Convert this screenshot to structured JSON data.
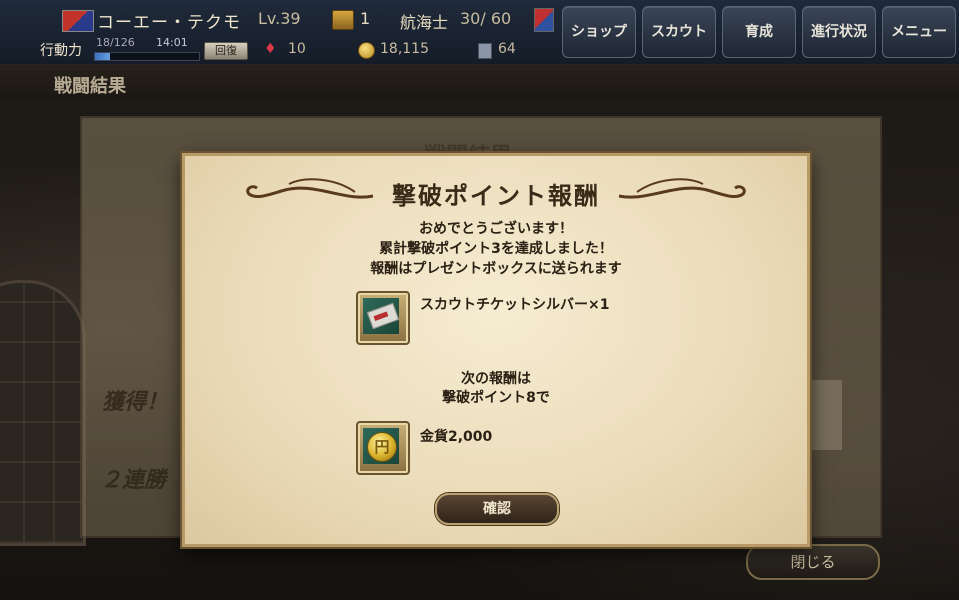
{
  "header": {
    "player_name": "コーエー・テクモ",
    "level": "Lv.39",
    "chest_count": "1",
    "rank_label": "航海士",
    "rank_value": "30/ 60",
    "ap_label": "行動力",
    "ap_value": "18/126",
    "ap_fraction": 0.14,
    "ap_time": "14:01",
    "recover_label": "回復",
    "gem_count": "10",
    "gold_count": "18,115",
    "doc_count": "64"
  },
  "nav": {
    "shop": "ショップ",
    "scout": "スカウト",
    "training": "育成",
    "progress": "進行状況",
    "menu": "メニュー"
  },
  "screen_title": "戦闘結果",
  "background_panel": {
    "heading": "戦闘結果",
    "acquired": "獲得！",
    "win_streak": "２連勝",
    "close_label": "閉じる"
  },
  "dialog": {
    "title": "撃破ポイント報酬",
    "line1": "おめでとうございます！",
    "line2": "累計撃破ポイント3を達成しました！",
    "line3": "報酬はプレゼントボックスに送られます",
    "reward_item": "スカウトチケットシルバー×1",
    "next_line1": "次の報酬は",
    "next_line2": "撃破ポイント8で",
    "next_item": "金貨2,000",
    "coin_glyph": "円",
    "confirm_label": "確認"
  },
  "colors": {
    "accent_gold": "#b89a68",
    "dialog_bg": "#f6ecd2",
    "text_dark": "#2a2014"
  }
}
